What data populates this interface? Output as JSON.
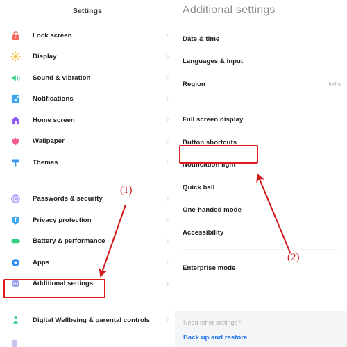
{
  "left_panel": {
    "header_title": "Settings",
    "groups": [
      {
        "items": [
          {
            "label": "Lock screen",
            "icon": "lock-icon",
            "color": "#f36a5a"
          },
          {
            "label": "Display",
            "icon": "sun-icon",
            "color": "#f7c548"
          },
          {
            "label": "Sound & vibration",
            "icon": "speaker-icon",
            "color": "#3ecf8e"
          },
          {
            "label": "Notifications",
            "icon": "notification-icon",
            "color": "#3ba7f0"
          },
          {
            "label": "Home screen",
            "icon": "home-icon",
            "color": "#8b5cf6"
          },
          {
            "label": "Wallpaper",
            "icon": "wallpaper-icon",
            "color": "#f25c8f"
          },
          {
            "label": "Themes",
            "icon": "themes-icon",
            "color": "#3b9ae8"
          }
        ]
      },
      {
        "items": [
          {
            "label": "Passwords & security",
            "icon": "fingerprint-icon",
            "color": "#a78bfa"
          },
          {
            "label": "Privacy protection",
            "icon": "shield-icon",
            "color": "#3ba7f0"
          },
          {
            "label": "Battery & performance",
            "icon": "battery-icon",
            "color": "#35d07f"
          },
          {
            "label": "Apps",
            "icon": "apps-icon",
            "color": "#2b8ef0"
          },
          {
            "label": "Additional settings",
            "icon": "additional-settings-icon",
            "color": "#9aa4e8"
          }
        ]
      },
      {
        "items": [
          {
            "label": "Digital Wellbeing & parental controls",
            "icon": "wellbeing-icon",
            "color": "#3ecf8e"
          }
        ]
      }
    ]
  },
  "right_panel": {
    "header_title": "Additional settings",
    "groups": [
      {
        "items": [
          {
            "label": "Date & time",
            "value": ""
          },
          {
            "label": "Languages & input",
            "value": ""
          },
          {
            "label": "Region",
            "value": "India"
          }
        ]
      },
      {
        "items": [
          {
            "label": "Full screen display",
            "value": ""
          },
          {
            "label": "Button shortcuts",
            "value": ""
          },
          {
            "label": "Notification light",
            "value": ""
          },
          {
            "label": "Quick ball",
            "value": ""
          },
          {
            "label": "One-handed mode",
            "value": ""
          },
          {
            "label": "Accessibility",
            "value": ""
          }
        ]
      },
      {
        "items": [
          {
            "label": "Enterprise mode",
            "value": ""
          }
        ]
      }
    ],
    "footer": {
      "hint": "Need other settings?",
      "link": "Back up and restore"
    }
  },
  "annotations": {
    "color": "#d11b1b",
    "step_one_label": "(1)",
    "step_two_label": "(2)",
    "highlight_left": "Additional settings",
    "highlight_right": "Button shortcuts"
  }
}
